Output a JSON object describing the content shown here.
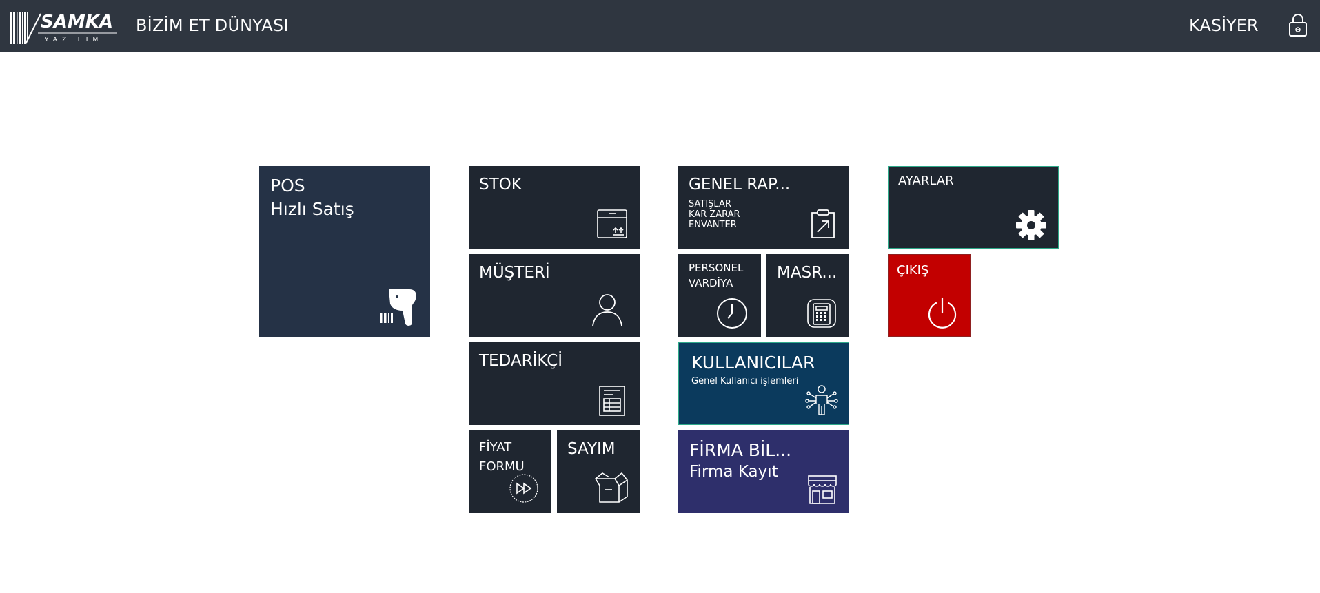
{
  "header": {
    "logo_title": "SAMKA",
    "logo_subtitle": "YAZILIM",
    "company": "BİZİM ET DÜNYASI",
    "user": "KASİYER"
  },
  "tiles": {
    "pos": {
      "title": "POS",
      "subtitle": "Hızlı Satış"
    },
    "stok": {
      "title": "STOK"
    },
    "musteri": {
      "title": "MÜŞTERİ"
    },
    "tedarikci": {
      "title": "TEDARİKÇİ"
    },
    "fiyat": {
      "line1": "FİYAT",
      "line2": "FORMU"
    },
    "sayim": {
      "title": "SAYIM"
    },
    "genel_rapor": {
      "title": "GENEL RAP...",
      "line1": "SATIŞLAR",
      "line2": "KAR ZARAR",
      "line3": "ENVANTER"
    },
    "personel": {
      "line1": "PERSONEL",
      "line2": "VARDİYA"
    },
    "masraf": {
      "title": "MASR..."
    },
    "kullanicilar": {
      "title": "KULLANICILAR",
      "subtitle": "Genel Kullanıcı işlemleri"
    },
    "firma": {
      "title": "FİRMA BİL...",
      "subtitle": "Firma Kayıt"
    },
    "ayarlar": {
      "title": "AYARLAR"
    },
    "cikis": {
      "title": "ÇIKIŞ"
    }
  },
  "colors": {
    "topbar": "#2f3640",
    "tile_dark": "#1f2630",
    "tile_pos": "#253246",
    "tile_users": "#0b3a5d",
    "tile_firm": "#2e2f6b",
    "tile_exit": "#c20000",
    "accent_border": "#2ea98a"
  },
  "icons": {
    "pos": "barcode-scanner-icon",
    "stok": "box-icon",
    "musteri": "user-icon",
    "tedarikci": "document-icon",
    "fiyat": "fast-forward-icon",
    "sayim": "open-box-icon",
    "genel_rapor": "clipboard-arrow-icon",
    "personel": "clock-icon",
    "masraf": "calculator-icon",
    "kullanicilar": "network-user-icon",
    "firma": "store-icon",
    "ayarlar": "gear-icon",
    "cikis": "power-icon",
    "header_lock": "lock-icon"
  }
}
